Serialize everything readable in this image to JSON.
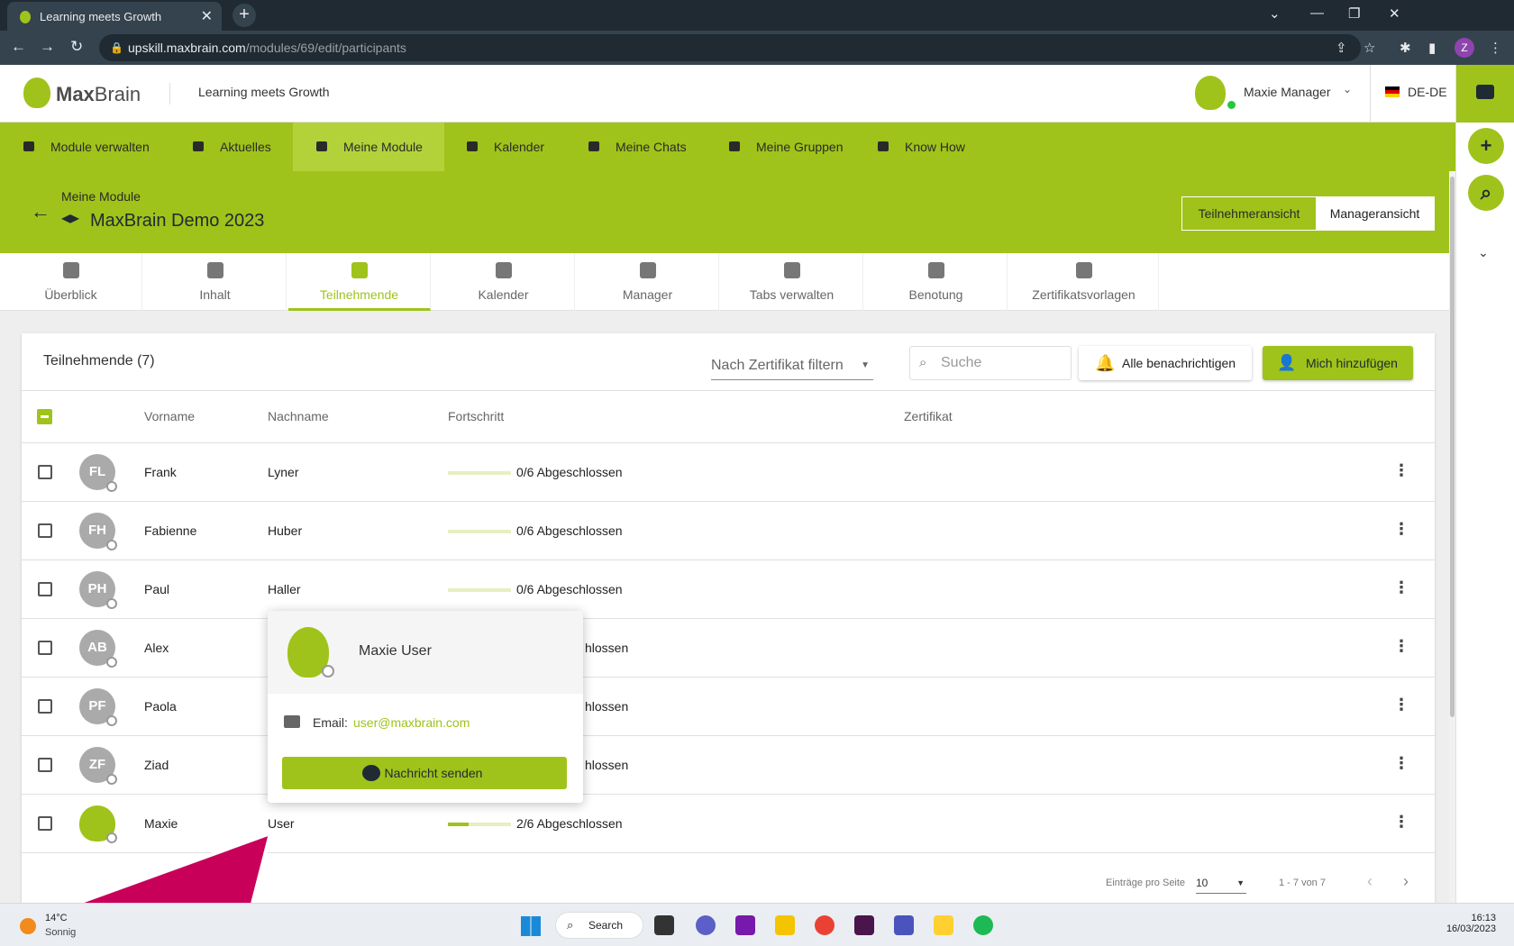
{
  "browser": {
    "tab_title": "Learning meets Growth",
    "url_host": "upskill.maxbrain.com",
    "url_path": "/modules/69/edit/participants",
    "profile_initial": "Z"
  },
  "header": {
    "logo_bold": "Max",
    "logo_light": "Brain",
    "tagline": "Learning meets Growth",
    "user_name": "Maxie Manager",
    "language": "DE-DE"
  },
  "nav": {
    "items": [
      {
        "label": "Module verwalten",
        "active": false
      },
      {
        "label": "Aktuelles",
        "active": false
      },
      {
        "label": "Meine Module",
        "active": true
      },
      {
        "label": "Kalender",
        "active": false
      },
      {
        "label": "Meine Chats",
        "active": false
      },
      {
        "label": "Meine Gruppen",
        "active": false
      },
      {
        "label": "Know How",
        "active": false
      }
    ]
  },
  "module": {
    "breadcrumb": "Meine Module",
    "title": "MaxBrain Demo 2023",
    "view_participant": "Teilnehmeransicht",
    "view_manager": "Manageransicht"
  },
  "subtabs": [
    {
      "label": "Überblick",
      "icon": "dashboard-icon"
    },
    {
      "label": "Inhalt",
      "icon": "folder-icon"
    },
    {
      "label": "Teilnehmende",
      "icon": "people-icon",
      "active": true
    },
    {
      "label": "Kalender",
      "icon": "calendar-icon"
    },
    {
      "label": "Manager",
      "icon": "manager-icon"
    },
    {
      "label": "Tabs verwalten",
      "icon": "window-icon"
    },
    {
      "label": "Benotung",
      "icon": "grade-icon"
    },
    {
      "label": "Zertifikatsvorlagen",
      "icon": "certificate-settings-icon"
    }
  ],
  "participants": {
    "title": "Teilnehmende (7)",
    "filter_placeholder": "Nach Zertifikat filtern",
    "search_placeholder": "Suche",
    "notify_label": "Alle benachrichtigen",
    "add_me_label": "Mich hinzufügen",
    "columns": {
      "firstname": "Vorname",
      "lastname": "Nachname",
      "progress": "Fortschritt",
      "certificate": "Zertifikat"
    },
    "rows": [
      {
        "initials": "FL",
        "firstname": "Frank",
        "lastname": "Lyner",
        "progress_text": "0/6 Abgeschlossen",
        "progress": 0
      },
      {
        "initials": "FH",
        "firstname": "Fabienne",
        "lastname": "Huber",
        "progress_text": "0/6 Abgeschlossen",
        "progress": 0
      },
      {
        "initials": "PH",
        "firstname": "Paul",
        "lastname": "Haller",
        "progress_text": "0/6 Abgeschlossen",
        "progress": 0
      },
      {
        "initials": "AB",
        "firstname": "Alex",
        "lastname": "",
        "progress_text": "hlossen",
        "progress": 0
      },
      {
        "initials": "PF",
        "firstname": "Paola",
        "lastname": "",
        "progress_text": "hlossen",
        "progress": 0
      },
      {
        "initials": "ZF",
        "firstname": "Ziad",
        "lastname": "",
        "progress_text": "hlossen",
        "progress": 0
      },
      {
        "initials": "",
        "firstname": "Maxie",
        "lastname": "User",
        "progress_text": "2/6 Abgeschlossen",
        "progress": 0.333
      }
    ],
    "pager": {
      "per_page_label": "Einträge pro Seite",
      "per_page": "10",
      "range": "1 - 7 von 7"
    }
  },
  "popup": {
    "name": "Maxie User",
    "email_label": "Email:",
    "email": "user@maxbrain.com",
    "message_button": "Nachricht senden"
  },
  "taskbar": {
    "temp": "14°C",
    "weather": "Sonnig",
    "search": "Search",
    "time": "16:13",
    "date": "16/03/2023"
  },
  "colors": {
    "accent": "#9fc31a",
    "annotation": "#c8005a"
  }
}
